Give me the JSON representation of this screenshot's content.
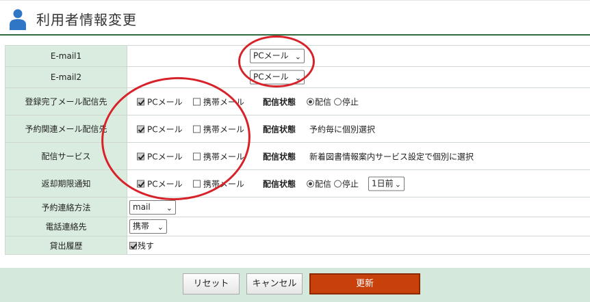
{
  "header": {
    "title": "利用者情報変更",
    "icon": "user-icon"
  },
  "rows": {
    "email1": {
      "label": "E-mail1",
      "select": "PCメール"
    },
    "email2": {
      "label": "E-mail2",
      "select": "PCメール"
    },
    "registration": {
      "label": "登録完了メール配信先",
      "pc_label": "PCメール",
      "mobile_label": "携帯メール",
      "status_label": "配信状態",
      "deliver_label": "配信",
      "stop_label": "停止"
    },
    "reservation": {
      "label": "予約関連メール配信先",
      "pc_label": "PCメール",
      "mobile_label": "携帯メール",
      "status_label": "配信状態",
      "note": "予約毎に個別選択"
    },
    "delivery_service": {
      "label": "配信サービス",
      "pc_label": "PCメール",
      "mobile_label": "携帯メール",
      "status_label": "配信状態",
      "note": "新着図書情報案内サービス設定で個別に選択"
    },
    "return_notice": {
      "label": "返却期限通知",
      "pc_label": "PCメール",
      "mobile_label": "携帯メール",
      "status_label": "配信状態",
      "deliver_label": "配信",
      "stop_label": "停止",
      "timing_select": "1日前"
    },
    "contact_method": {
      "label": "予約連絡方法",
      "select": "mail"
    },
    "phone_contact": {
      "label": "電話連絡先",
      "select": "携帯"
    },
    "loan_history": {
      "label": "貸出履歴",
      "keep_label": "残す"
    }
  },
  "buttons": {
    "reset": "リセット",
    "cancel": "キャンセル",
    "update": "更新"
  },
  "colors": {
    "label_bg": "#d9ecdf",
    "header_line": "#2e6b3c",
    "footer_bg": "#d5e8dc",
    "primary": "#c8410b",
    "annotation": "#d8222a"
  }
}
